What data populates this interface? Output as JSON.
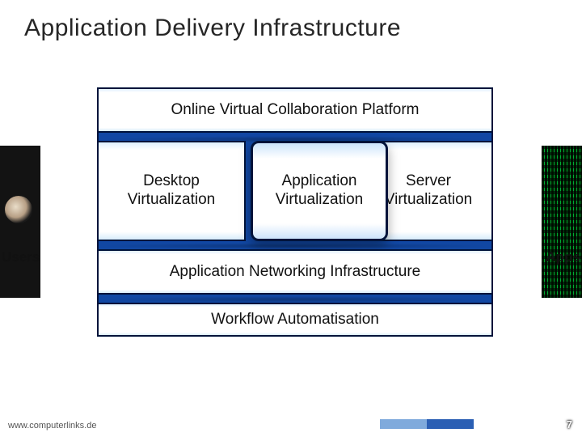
{
  "title": "Application Delivery Infrastructure",
  "boxes": {
    "header": "Online Virtual Collaboration Platform",
    "desktop": "Desktop\nVirtualization",
    "app": "Application\nVirtualization",
    "server": "Server\nVirtualization",
    "ani": "Application Networking Infrastructure",
    "wfa": "Workflow Automatisation"
  },
  "sides": {
    "users": "Users",
    "apps": "Apps"
  },
  "footer": {
    "url": "www.computerlinks.de",
    "page": "7"
  }
}
